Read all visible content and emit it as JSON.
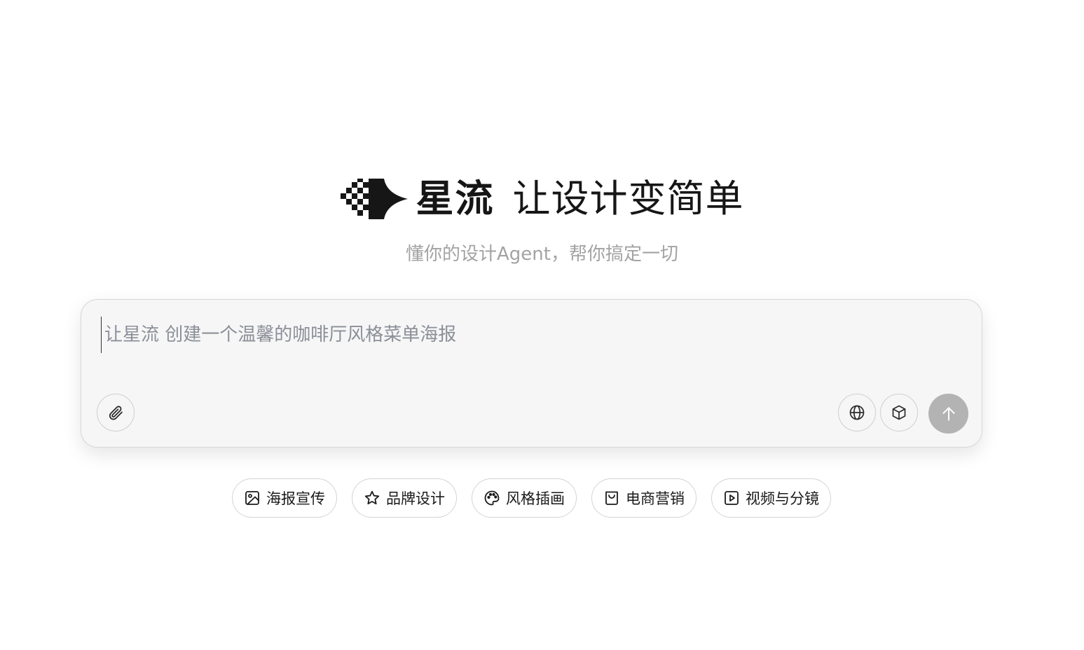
{
  "header": {
    "logo_icon": "xingliu-arrow-logo",
    "brand_name": "星流",
    "tagline": "让设计变简单",
    "subtitle": "懂你的设计Agent，帮你搞定一切"
  },
  "composer": {
    "placeholder": "让星流 创建一个温馨的咖啡厅风格菜单海报",
    "value": "",
    "buttons": {
      "attach_icon": "paperclip-icon",
      "globe_icon": "globe-icon",
      "cube_icon": "cube-icon",
      "send_icon": "arrow-up-icon"
    }
  },
  "chips": [
    {
      "label": "海报宣传",
      "icon": "image-icon"
    },
    {
      "label": "品牌设计",
      "icon": "star-icon"
    },
    {
      "label": "风格插画",
      "icon": "palette-icon"
    },
    {
      "label": "电商营销",
      "icon": "shopping-bag-icon"
    },
    {
      "label": "视频与分镜",
      "icon": "play-square-icon"
    }
  ],
  "colors": {
    "text_primary": "#161616",
    "text_muted": "#a3a3a3",
    "placeholder": "#8b8f98",
    "composer_bg": "#f6f6f6",
    "send_disabled": "#b3b3b3"
  }
}
